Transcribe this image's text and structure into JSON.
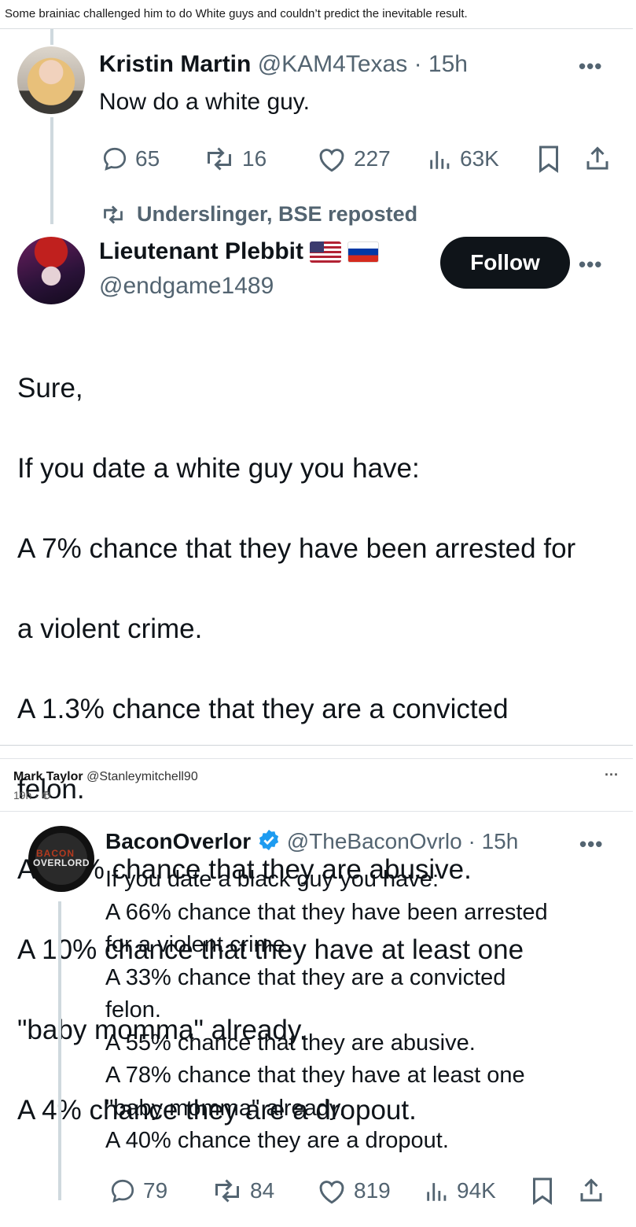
{
  "caption": "Some brainiac challenged him to do White guys and couldn’t predict the inevitable result.",
  "tweet1": {
    "author": "Kristin Martin",
    "handle": "@KAM4Texas",
    "time": "· 15h",
    "text": "Now do a white guy.",
    "more": "•••",
    "stats": {
      "replies": "65",
      "reposts": "16",
      "likes": "227",
      "views": "63K"
    }
  },
  "repost_banner": "Underslinger, BSE reposted",
  "tweet2": {
    "author": "Lieutenant Plebbit",
    "handle": "@endgame1489",
    "follow_label": "Follow",
    "more": "•••",
    "lines": [
      "Sure,",
      "If you date a white guy you have:",
      "A 7% chance that they have been arrested for",
      "a violent crime.",
      "A 1.3% chance that they are a convicted",
      "felon.",
      "A 0.6% chance that they are abusive.",
      "A 10% chance that they have at least one",
      "\"baby momma\" already.",
      "A 4% chance they are a dropout."
    ]
  },
  "comment": {
    "name": "Mark Taylor",
    "handle": "@Stanleymitchell90",
    "time": "19h ·",
    "more": "···"
  },
  "tweet3": {
    "author": "BaconOverlor",
    "handle": "@TheBaconOvrlo",
    "time": "· 15h",
    "more": "•••",
    "avatar_top": "BACON",
    "avatar_bottom": "OVERLORD",
    "lines": [
      "If you date a black guy you have:",
      "A 66% chance that they have been arrested",
      "for a violent crime.",
      "A 33% chance that they are a convicted",
      "felon.",
      "A 55% chance that they are abusive.",
      "A 78% chance that they have at least one",
      "\"baby momma\" already.",
      "A 40% chance they are a dropout."
    ],
    "stats": {
      "replies": "79",
      "reposts": "84",
      "likes": "819",
      "views": "94K"
    }
  },
  "colors": {
    "text": "#0f1419",
    "muted": "#536471",
    "thread": "#cfd9de",
    "verified": "#1d9bf0"
  }
}
